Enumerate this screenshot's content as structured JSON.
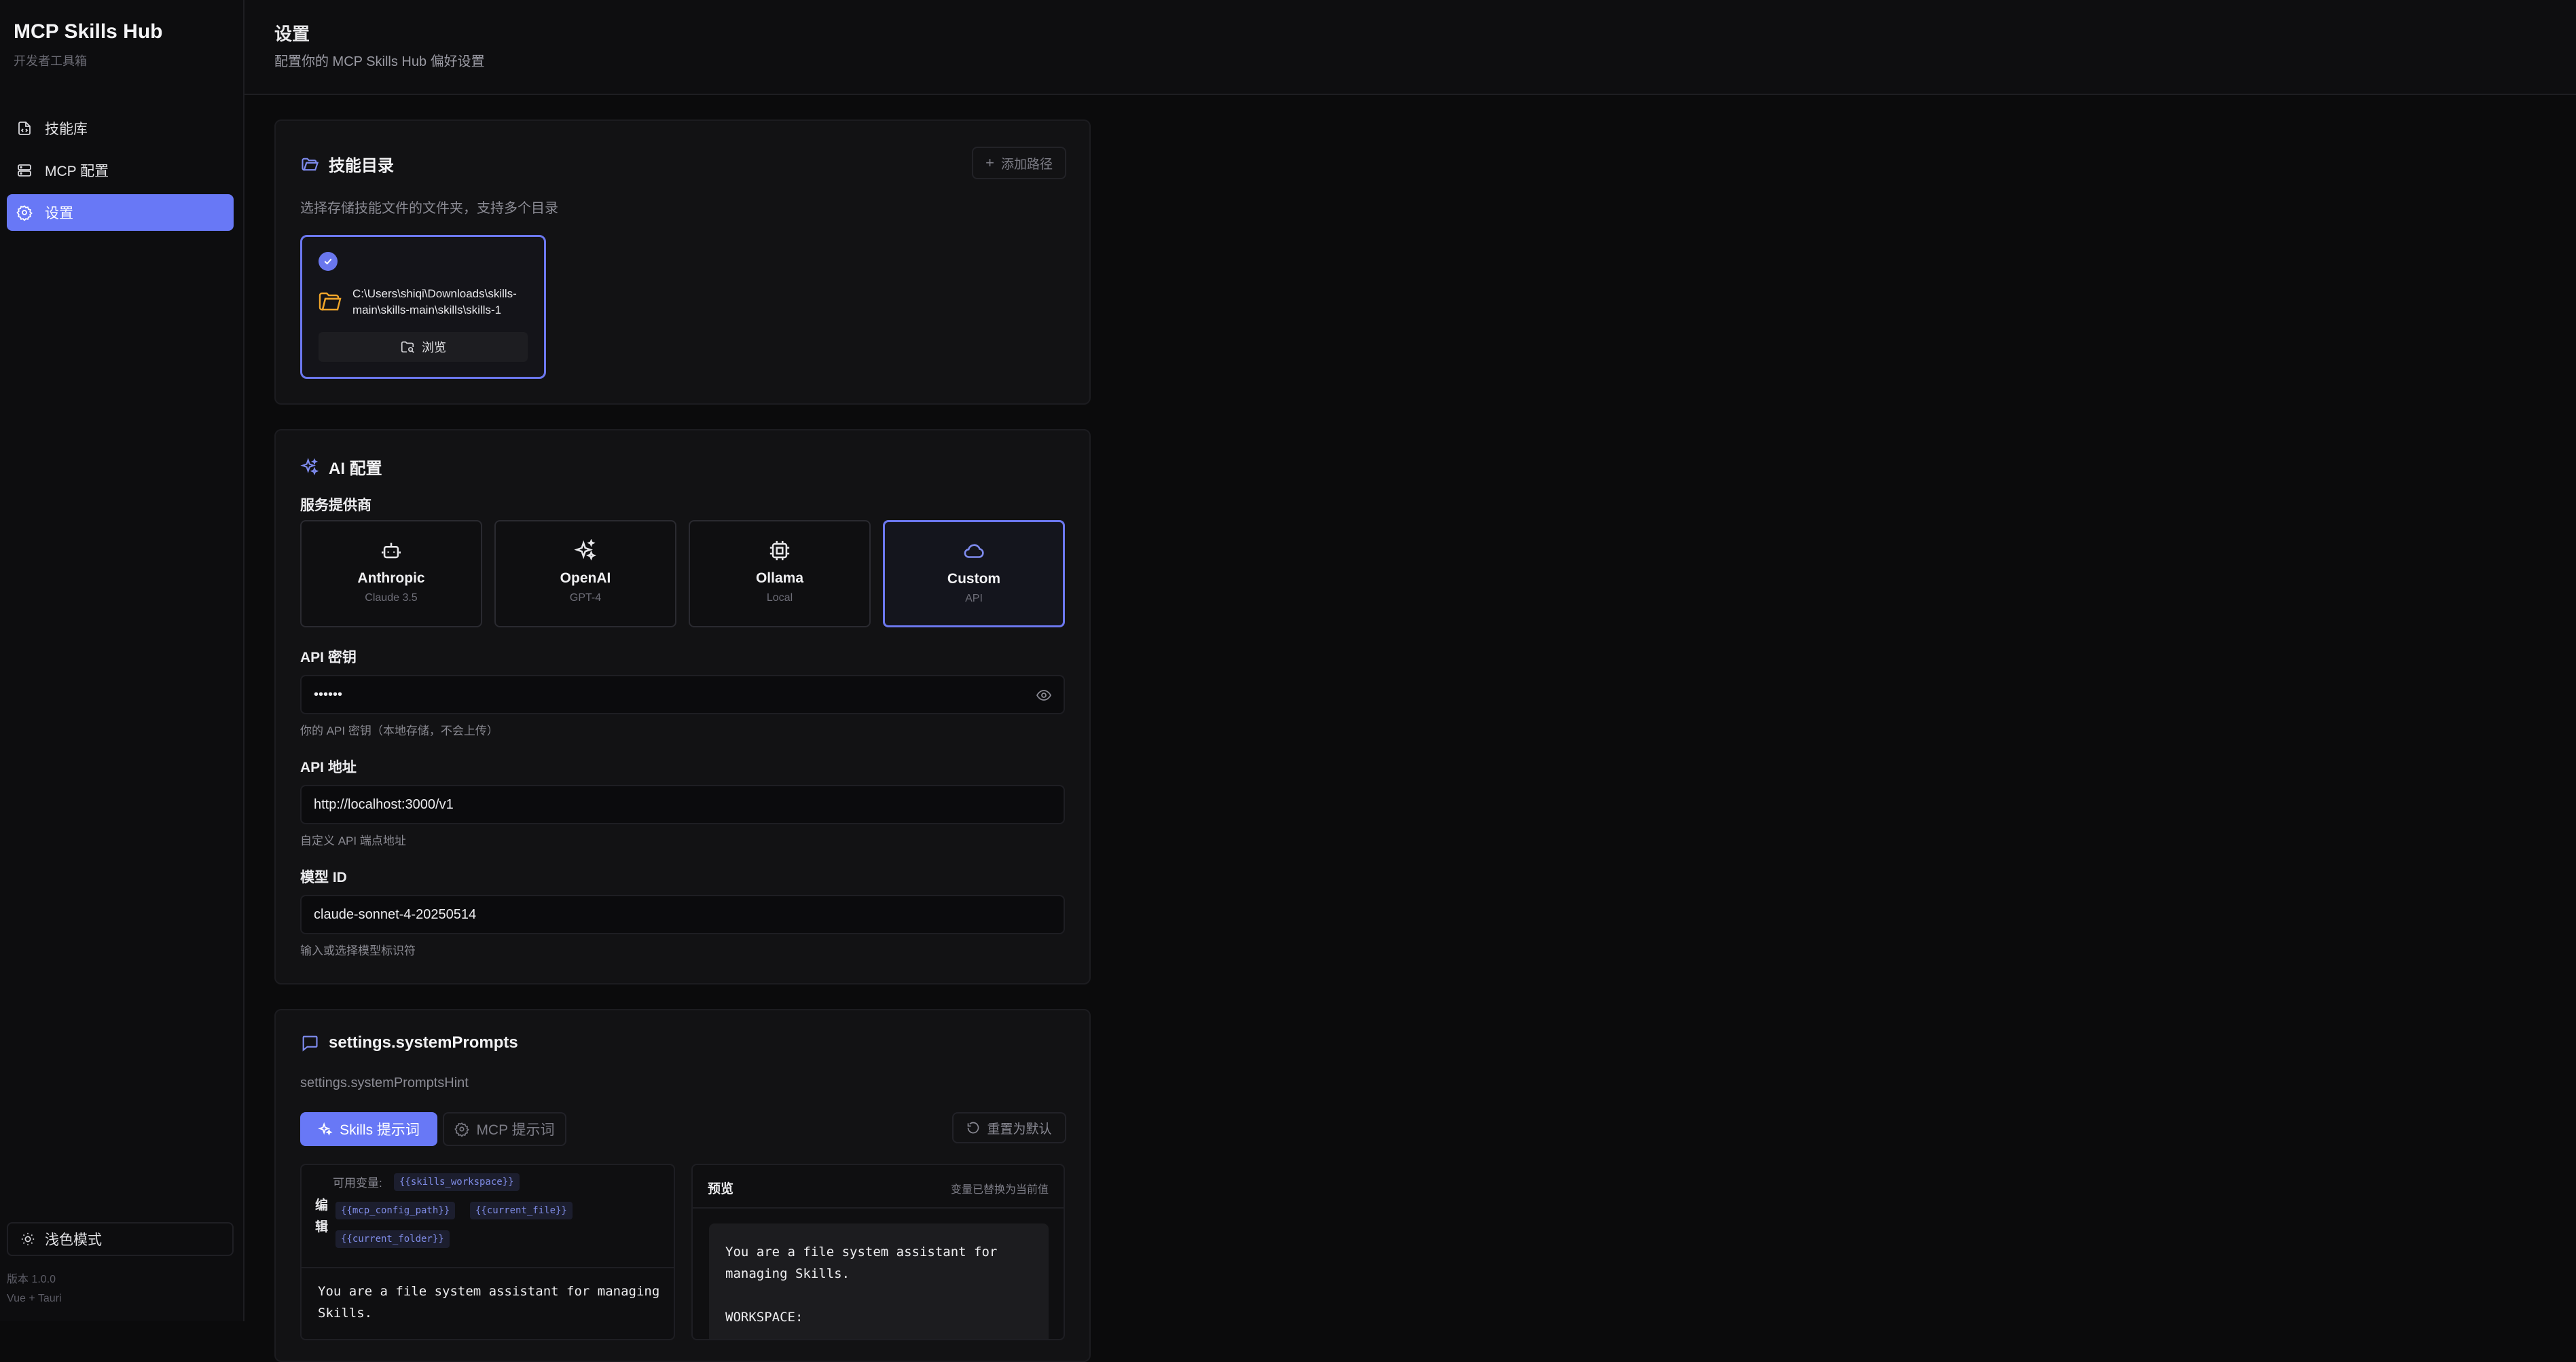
{
  "sidebar": {
    "title": "MCP Skills Hub",
    "subtitle": "开发者工具箱",
    "items": [
      {
        "label": "技能库",
        "icon": "file-code-icon"
      },
      {
        "label": "MCP 配置",
        "icon": "server-icon"
      },
      {
        "label": "设置",
        "icon": "gear-icon",
        "active": true
      }
    ],
    "theme_toggle": "浅色模式",
    "version": "版本 1.0.0",
    "stack": "Vue + Tauri"
  },
  "header": {
    "title": "设置",
    "subtitle": "配置你的 MCP Skills Hub 偏好设置"
  },
  "skills_dir": {
    "title": "技能目录",
    "add_path": "添加路径",
    "hint": "选择存储技能文件的文件夹，支持多个目录",
    "path": "C:\\Users\\shiqi\\Downloads\\skills-main\\skills-main\\skills\\skills-1",
    "browse": "浏览"
  },
  "ai": {
    "title": "AI 配置",
    "provider_label": "服务提供商",
    "providers": [
      {
        "name": "Anthropic",
        "sub": "Claude 3.5",
        "icon": "robot-icon"
      },
      {
        "name": "OpenAI",
        "sub": "GPT-4",
        "icon": "sparkles-icon"
      },
      {
        "name": "Ollama",
        "sub": "Local",
        "icon": "cpu-icon"
      },
      {
        "name": "Custom",
        "sub": "API",
        "icon": "cloud-icon",
        "selected": true
      }
    ],
    "api_key_label": "API 密钥",
    "api_key_value": "••••••",
    "api_key_hint": "你的 API 密钥（本地存储，不会上传）",
    "api_url_label": "API 地址",
    "api_url_value": "http://localhost:3000/v1",
    "api_url_hint": "自定义 API 端点地址",
    "model_label": "模型 ID",
    "model_value": "claude-sonnet-4-20250514",
    "model_hint": "输入或选择模型标识符"
  },
  "prompts": {
    "title": "settings.systemPrompts",
    "hint": "settings.systemPromptsHint",
    "tab_skills": "Skills 提示词",
    "tab_mcp": "MCP 提示词",
    "reset": "重置为默认",
    "editor_label": "编辑",
    "vars_label": "可用变量:",
    "vars": [
      "{{skills_workspace}}",
      "{{mcp_config_path}}",
      "{{current_file}}",
      "{{current_folder}}"
    ],
    "editor_text": "You are a file system assistant for managing\nSkills.",
    "preview_title": "预览",
    "preview_note": "变量已替换为当前值",
    "preview_text": "You are a file system assistant for\nmanaging Skills.\n\nWORKSPACE:"
  },
  "colors": {
    "accent": "#6878f6",
    "folder": "#f0a52a",
    "background": "#0b0b0c"
  }
}
